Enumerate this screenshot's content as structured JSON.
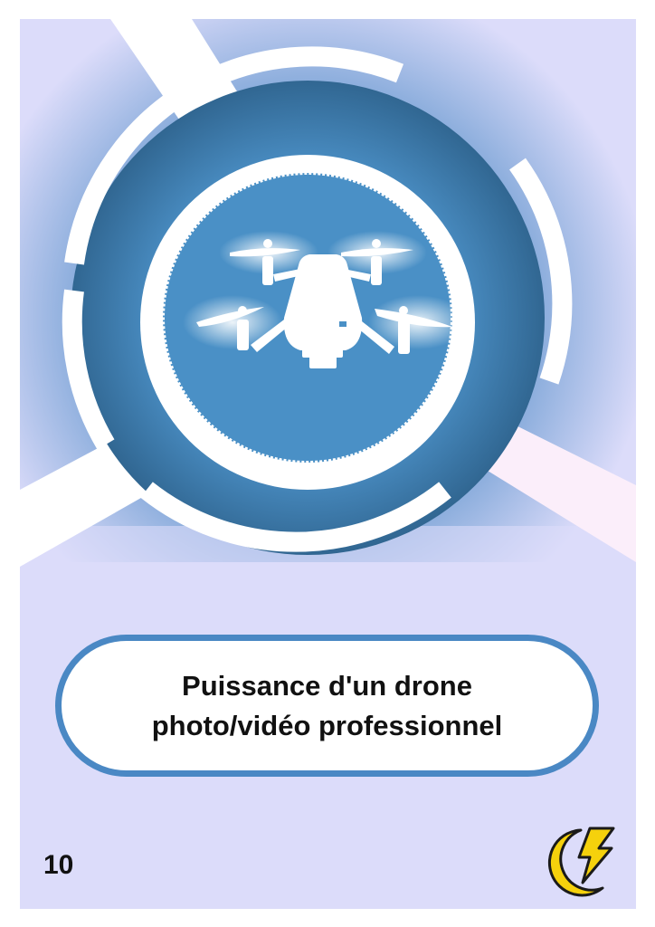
{
  "card": {
    "title_line1": "Puissance d'un drone",
    "title_line2": "photo/vidéo professionnel",
    "number": "10"
  },
  "icons": {
    "illustration": "drone-icon",
    "badge": "lightning-moon-icon"
  },
  "colors": {
    "background": "#dcdcfa",
    "ring_dark": "#3a6f9a",
    "ring_light": "#4a90c6",
    "beam": "#ffffff",
    "beam_pink": "#fbeefa",
    "title_border": "#4a88c4",
    "badge_yellow": "#f5d10c"
  }
}
